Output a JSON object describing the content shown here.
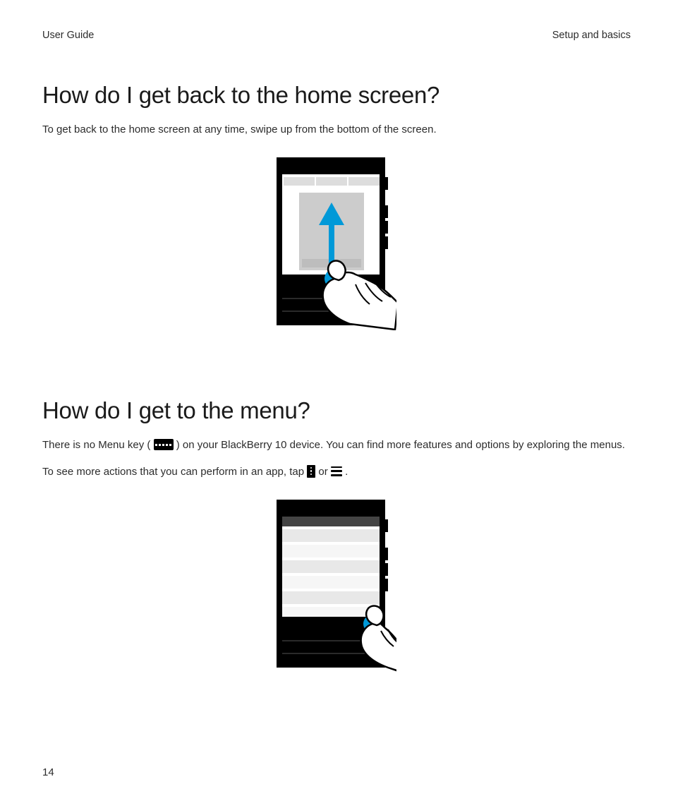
{
  "header": {
    "left": "User Guide",
    "right": "Setup and basics"
  },
  "section1": {
    "title": "How do I get back to the home screen?",
    "p1": "To get back to the home screen at any time, swipe up from the bottom of the screen."
  },
  "section2": {
    "title": "How do I get to the menu?",
    "p1a": "There is no Menu key ( ",
    "p1b": " ) on your BlackBerry 10 device. You can find more features and options by exploring the menus.",
    "p2a": "To see more actions that you can perform in an app, tap ",
    "p2b": " or ",
    "p2c": " ."
  },
  "pageNumber": "14"
}
